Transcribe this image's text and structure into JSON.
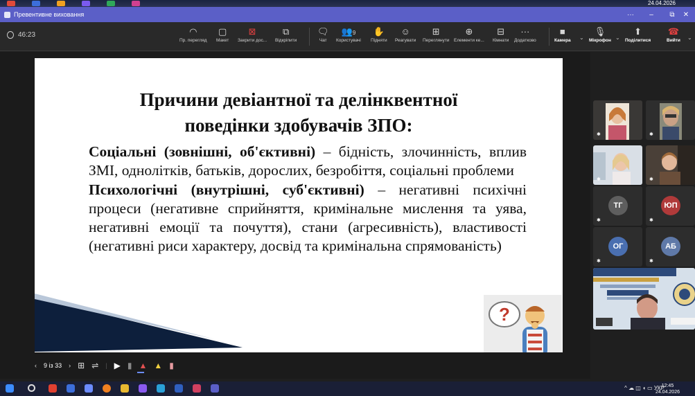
{
  "top_strip": {
    "date": "24.04.2026"
  },
  "window": {
    "title": "Превентивне виховання",
    "controls": {
      "more": "···",
      "minimize": "–",
      "restore": "⧉",
      "close": "✕"
    }
  },
  "meeting": {
    "timer": "46:23",
    "toolbar": [
      {
        "id": "view",
        "icon": "◠",
        "label": "Пр. перегляд"
      },
      {
        "id": "layout",
        "icon": "▢",
        "label": "Макет"
      },
      {
        "id": "stop-share",
        "icon": "⊠",
        "label": "Закрити дос..."
      },
      {
        "id": "pop-out",
        "icon": "⧉",
        "label": "Відкріпити"
      },
      {
        "id": "chat",
        "icon": "🗨",
        "label": "Чат"
      },
      {
        "id": "people",
        "icon": "👥",
        "label": "Користувачі",
        "count": "9"
      },
      {
        "id": "raise",
        "icon": "✋",
        "label": "Підняти"
      },
      {
        "id": "react",
        "icon": "☺",
        "label": "Реагувати"
      },
      {
        "id": "view2",
        "icon": "⊞",
        "label": "Переглянути"
      },
      {
        "id": "apps",
        "icon": "⊕",
        "label": "Елементи ке..."
      },
      {
        "id": "rooms",
        "icon": "⊟",
        "label": "Кімнати"
      },
      {
        "id": "more",
        "icon": "···",
        "label": "Додатково"
      },
      {
        "id": "camera",
        "icon": "■",
        "label": "Камера"
      },
      {
        "id": "mic",
        "icon": "🎙",
        "label": "Мікрофон"
      },
      {
        "id": "share",
        "icon": "⬆",
        "label": "Поділитися"
      },
      {
        "id": "leave",
        "icon": "☎",
        "label": "Вийти"
      }
    ]
  },
  "slide": {
    "title_line1": "Причини девіантної та делінквентної",
    "title_line2": "поведінки здобувачів ЗПО:",
    "p1_head": "Соціальні (зовнішні, об'єктивні)",
    "p1_text": " – бідність, злочинність, вплив ЗМІ, однолітків, батьків, дорослих, безробіття, соціальні проблеми",
    "p2_head": "Психологічні (внутрішні, суб'єктивні)",
    "p2_text": " – негативні психічні процеси (негативне сприйняття, кримінальне мислення та уява, негативні емоції та почуття), стани (агресивність), властивості (негативні риси характеру, досвід та кримінальна спрямованість)"
  },
  "slide_nav": {
    "prev": "‹",
    "page": "9 із 33",
    "next": "›"
  },
  "participants": [
    {
      "type": "photo",
      "initials": ""
    },
    {
      "type": "photo",
      "initials": ""
    },
    {
      "type": "photo",
      "initials": ""
    },
    {
      "type": "photo",
      "initials": ""
    },
    {
      "type": "avatar",
      "initials": "ТГ",
      "color": "#5e5e5e"
    },
    {
      "type": "avatar",
      "initials": "ЮП",
      "color": "#b03a3a"
    },
    {
      "type": "avatar",
      "initials": "ОГ",
      "color": "#4a6fb0"
    },
    {
      "type": "avatar",
      "initials": "АБ",
      "color": "#5f79a8"
    }
  ],
  "taskbar": {
    "lang": "УКР",
    "time": "12:45",
    "date": "24.04.2026"
  }
}
